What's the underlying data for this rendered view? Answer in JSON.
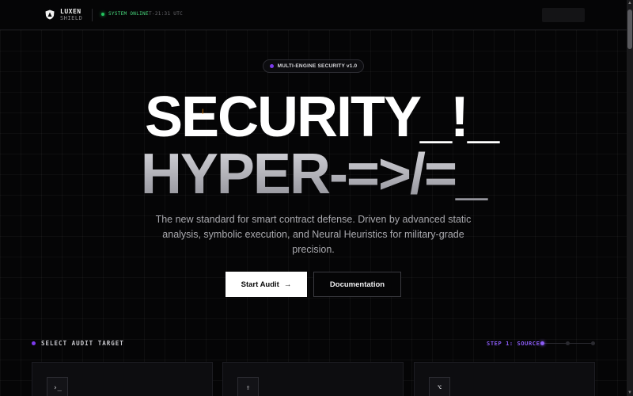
{
  "header": {
    "brand_line1": "LUXEN",
    "brand_line2": "SHIELD",
    "status": "SYSTEM ONLINE",
    "time": "T-21:31 UTC"
  },
  "badge": {
    "label": "MULTI-ENGINE SECURITY v1.0"
  },
  "hero": {
    "line1": "SECURITY_!_",
    "line2": "HYPER-=>/=_"
  },
  "subtitle": "The new standard for smart contract defense. Driven by advanced static analysis, symbolic execution, and Neural Heuristics for military-grade precision.",
  "buttons": {
    "primary": "Start Audit",
    "primary_icon": "→",
    "secondary": "Documentation"
  },
  "section": {
    "title": "SELECT AUDIT TARGET",
    "step": "STEP 1: SOURCE"
  },
  "cards": [
    {
      "icon": "terminal-icon",
      "glyph": "›_"
    },
    {
      "icon": "file-upload-icon",
      "glyph": "⇪"
    },
    {
      "icon": "github-icon",
      "glyph": "⌥"
    }
  ],
  "colors": {
    "accent": "#7c3aed",
    "status": "#22c55e",
    "background": "#050506"
  }
}
